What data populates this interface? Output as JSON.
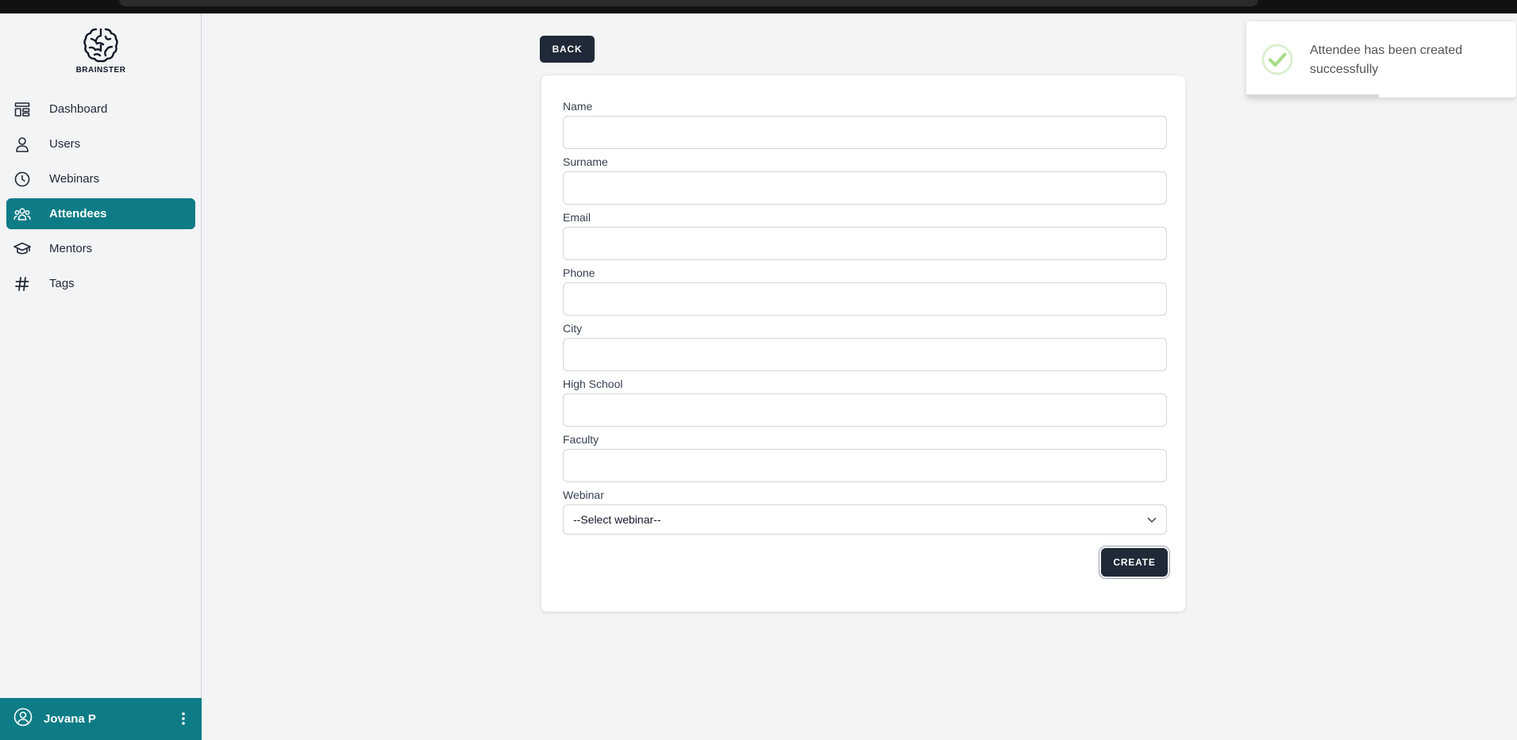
{
  "brand": {
    "name": "BRAINSTER"
  },
  "sidebar": {
    "items": [
      {
        "label": "Dashboard",
        "icon": "dashboard-icon",
        "active": false
      },
      {
        "label": "Users",
        "icon": "user-icon",
        "active": false
      },
      {
        "label": "Webinars",
        "icon": "clock-icon",
        "active": false
      },
      {
        "label": "Attendees",
        "icon": "users-group-icon",
        "active": true
      },
      {
        "label": "Mentors",
        "icon": "graduation-cap-icon",
        "active": false
      },
      {
        "label": "Tags",
        "icon": "hashtag-icon",
        "active": false
      }
    ],
    "user": {
      "name": "Jovana P",
      "icon": "user-circle-icon",
      "menu_icon": "kebab-menu-icon"
    }
  },
  "page": {
    "back_label": "BACK",
    "form": {
      "fields": [
        {
          "label": "Name",
          "value": ""
        },
        {
          "label": "Surname",
          "value": ""
        },
        {
          "label": "Email",
          "value": ""
        },
        {
          "label": "Phone",
          "value": ""
        },
        {
          "label": "City",
          "value": ""
        },
        {
          "label": "High School",
          "value": ""
        },
        {
          "label": "Faculty",
          "value": ""
        }
      ],
      "webinar": {
        "label": "Webinar",
        "selected": "--Select webinar--"
      },
      "submit_label": "CREATE"
    }
  },
  "toast": {
    "message": "Attendee has been created successfully",
    "icon": "success-check-icon",
    "progress_fraction": 0.49
  },
  "colors": {
    "accent": "#0e7c86",
    "button_dark": "#1f2937",
    "success": "#a5dc86"
  }
}
